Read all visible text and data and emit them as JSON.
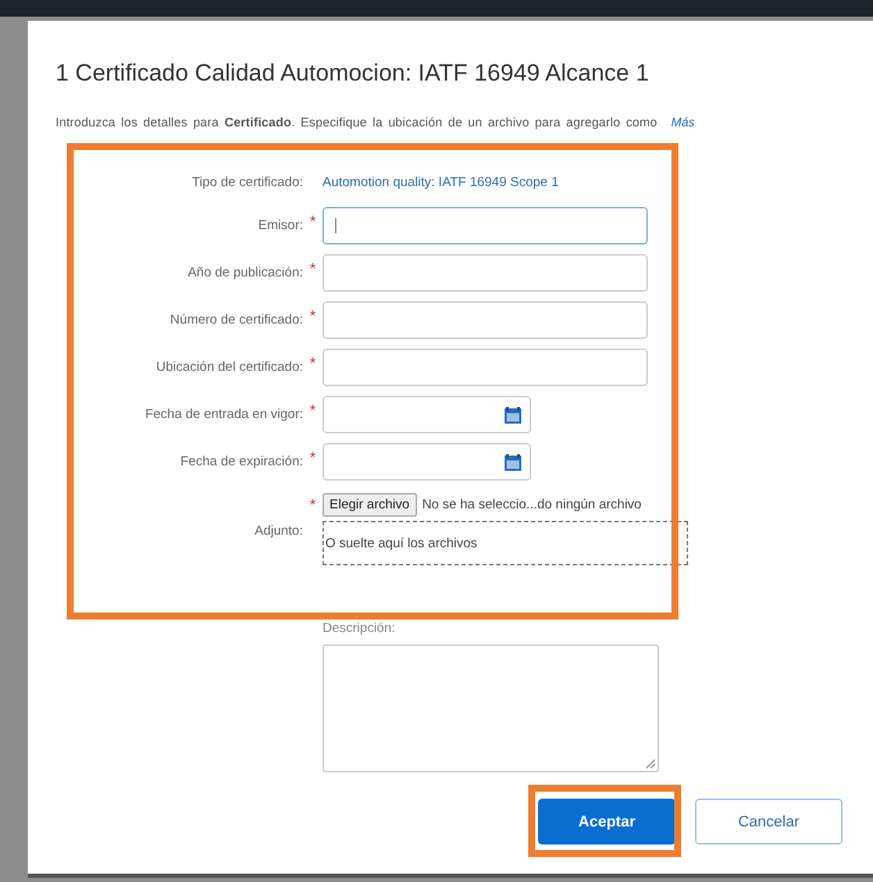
{
  "dialog": {
    "title": "1 Certificado Calidad Automocion: IATF 16949 Alcance 1",
    "intro": "Introduzca los detalles para **Certificado**. Especifique la ubicación de un archivo para agregarlo como",
    "intro_link": "Más",
    "fields": [
      {
        "kind": "readonly",
        "label": "Tipo de certificado:",
        "value": "Automotion quality: IATF 16949 Scope 1"
      },
      {
        "kind": "text",
        "label": "Emisor:",
        "required_mark": "*",
        "focused": true
      },
      {
        "kind": "text",
        "label": "Año de publicación:",
        "required_mark": "*",
        "focused": false
      },
      {
        "kind": "text",
        "label": "Número de certificado:",
        "required_mark": "*",
        "focused": false
      },
      {
        "kind": "text",
        "label": "Ubicación del certificado:",
        "required_mark": "*",
        "focused": false
      },
      {
        "kind": "date",
        "label": "Fecha de entrada en vigor:",
        "required_mark": "*"
      },
      {
        "kind": "date",
        "label": "Fecha de expiración:",
        "required_mark": "*"
      },
      {
        "kind": "file",
        "label": "Adjunto:",
        "required_mark": "*",
        "button": "Elegir archivo",
        "status": "No se ha seleccio...do ningún archivo",
        "drop": "O suelte aquí los archivos"
      }
    ],
    "description_label": "Descripción:",
    "buttons": [
      {
        "label": "Aceptar",
        "kind": "primary"
      },
      {
        "label": "Cancelar",
        "kind": "secondary"
      }
    ]
  }
}
